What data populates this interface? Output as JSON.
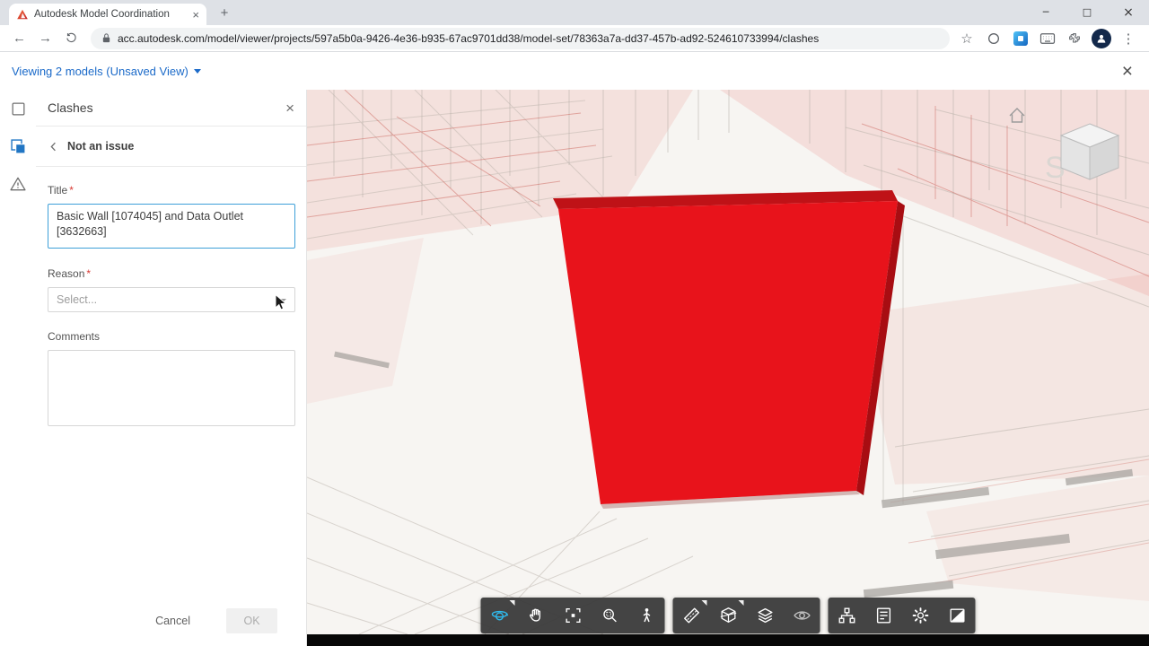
{
  "browser": {
    "tab": {
      "title": "Autodesk Model Coordination",
      "close_glyph": "×"
    },
    "new_tab_glyph": "+",
    "window": {
      "minimize": "─",
      "maximize": "□",
      "close": "×"
    },
    "nav": {
      "back": "←",
      "forward": "→",
      "bookmark_glyph": "☆",
      "menu_glyph": "⋮"
    },
    "url": "acc.autodesk.com/model/viewer/projects/597a5b0a-9426-4e36-b935-67ac9701dd38/model-set/78363a7a-dd37-457b-ad92-524610733994/clashes"
  },
  "app_header": {
    "viewing_label": "Viewing 2 models (Unsaved View)",
    "close_glyph": "×"
  },
  "rail": {
    "items": [
      "models",
      "clashes",
      "issues"
    ],
    "active": "clashes"
  },
  "panel": {
    "title": "Clashes",
    "close_glyph": "×",
    "back_label": "Not an issue",
    "form": {
      "title_label": "Title",
      "required_marker": "*",
      "title_value": "Basic Wall [1074045] and Data Outlet [3632663]",
      "reason_label": "Reason",
      "reason_placeholder": "Select...",
      "comments_label": "Comments",
      "comments_value": ""
    },
    "footer": {
      "cancel_label": "Cancel",
      "ok_label": "OK"
    }
  },
  "viewer": {
    "compass_letter": "S",
    "toolbar": {
      "groups": [
        {
          "tools": [
            "orbit",
            "pan",
            "fit-to-view",
            "zoom-window",
            "first-person"
          ],
          "active": "orbit"
        },
        {
          "tools": [
            "measure",
            "section",
            "layers",
            "visibility"
          ]
        },
        {
          "tools": [
            "model-browser",
            "properties",
            "settings",
            "render"
          ]
        }
      ]
    }
  },
  "colors": {
    "accent_blue": "#1b6ac9",
    "active_tool_blue": "#2fbbee",
    "clash_red": "#e8131b",
    "toolbar_bg": "#3a3a3a"
  }
}
